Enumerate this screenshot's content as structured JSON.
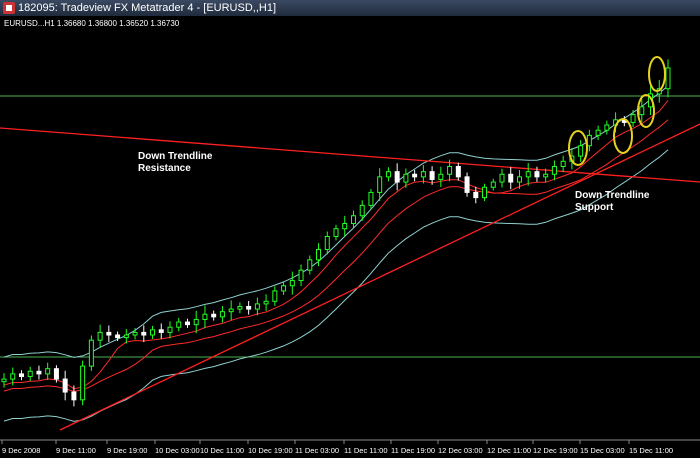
{
  "window": {
    "title": "182095: Tradeview FX Metatrader 4 - [EURUSD,,H1]"
  },
  "chart_info": "EURUSD...H1  1.36680 1.36800 1.36520 1.36730",
  "annotations": {
    "resistance": [
      "Down Trendline",
      "Resistance"
    ],
    "support": [
      "Down Trendline",
      "Support"
    ]
  },
  "chart_data": {
    "type": "candlestick",
    "x_ticks": [
      "9 Dec 2008",
      "9 Dec 11:00",
      "9 Dec 19:00",
      "10 Dec 03:00",
      "10 Dec 11:00",
      "10 Dec 19:00",
      "11 Dec 03:00",
      "11 Dec 11:00",
      "11 Dec 19:00",
      "12 Dec 03:00",
      "12 Dec 11:00",
      "12 Dec 19:00",
      "15 Dec 03:00",
      "15 Dec 11:00"
    ],
    "colors": {
      "bull": "#22ff22",
      "bear": "#ffffff",
      "band": "#90d0d0",
      "ma": "#ff2a2a",
      "trend": "#ff2020",
      "hline": "#4caf50",
      "highlight": "#e6d21e"
    },
    "price_path": [
      0,
      0.02,
      0.01,
      0.03,
      0.02,
      0.04,
      0.0,
      -0.05,
      -0.08,
      0.05,
      0.15,
      0.18,
      0.17,
      0.16,
      0.17,
      0.18,
      0.17,
      0.19,
      0.18,
      0.2,
      0.22,
      0.21,
      0.23,
      0.25,
      0.24,
      0.26,
      0.27,
      0.28,
      0.27,
      0.29,
      0.3,
      0.34,
      0.36,
      0.38,
      0.42,
      0.46,
      0.5,
      0.55,
      0.58,
      0.6,
      0.63,
      0.67,
      0.72,
      0.78,
      0.8,
      0.76,
      0.79,
      0.78,
      0.8,
      0.77,
      0.79,
      0.82,
      0.78,
      0.72,
      0.7,
      0.74,
      0.76,
      0.79,
      0.76,
      0.78,
      0.8,
      0.78,
      0.79,
      0.82,
      0.84,
      0.86,
      0.9,
      0.94,
      0.96,
      0.98,
      1.0,
      0.99,
      1.02,
      1.05,
      1.1,
      1.12,
      1.2
    ]
  }
}
